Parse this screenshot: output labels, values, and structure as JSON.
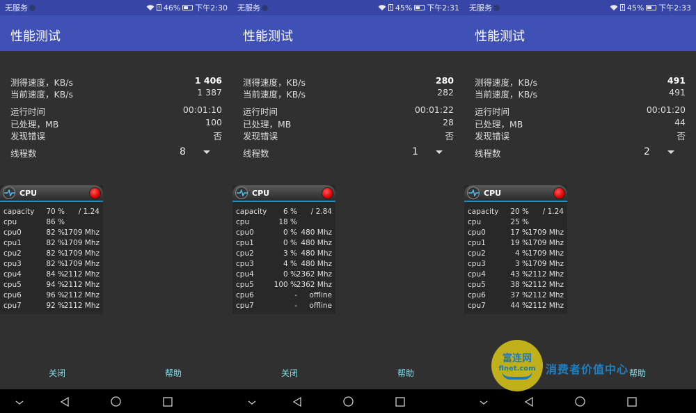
{
  "screens": [
    {
      "status": {
        "carrier": "无服务",
        "battery": "46%",
        "battery_level": 46,
        "time": "下午2:30"
      },
      "title": "性能测试",
      "stats": [
        {
          "label": "测得速度，KB/s",
          "value": "1 406",
          "bold": true
        },
        {
          "label": "当前速度，KB/s",
          "value": "1 387"
        },
        {
          "label": "运行时间",
          "value": "00:01:10"
        },
        {
          "label": "已处理，MB",
          "value": "100"
        },
        {
          "label": "发现错误",
          "value": "否"
        }
      ],
      "threads": {
        "label": "线程数",
        "value": "8"
      },
      "cpu": {
        "title": "CPU",
        "rows": [
          [
            "capacity",
            "70 %",
            "/ 1.24"
          ],
          [
            "cpu",
            "86 %",
            ""
          ],
          [
            "cpu0",
            "82 %",
            "1709 Mhz"
          ],
          [
            "cpu1",
            "82 %",
            "1709 Mhz"
          ],
          [
            "cpu2",
            "82 %",
            "1709 Mhz"
          ],
          [
            "cpu3",
            "82 %",
            "1709 Mhz"
          ],
          [
            "cpu4",
            "84 %",
            "2112 Mhz"
          ],
          [
            "cpu5",
            "94 %",
            "2112 Mhz"
          ],
          [
            "cpu6",
            "96 %",
            "2112 Mhz"
          ],
          [
            "cpu7",
            "92 %",
            "2112 Mhz"
          ]
        ]
      },
      "buttons": {
        "close": "关闭",
        "help": "帮助"
      }
    },
    {
      "status": {
        "carrier": "无服务",
        "battery": "45%",
        "battery_level": 45,
        "time": "下午2:31"
      },
      "title": "性能测试",
      "stats": [
        {
          "label": "测得速度，KB/s",
          "value": "280",
          "bold": true
        },
        {
          "label": "当前速度，KB/s",
          "value": "282"
        },
        {
          "label": "运行时间",
          "value": "00:01:22"
        },
        {
          "label": "已处理，MB",
          "value": "28"
        },
        {
          "label": "发现错误",
          "value": "否"
        }
      ],
      "threads": {
        "label": "线程数",
        "value": "1"
      },
      "cpu": {
        "title": "CPU",
        "rows": [
          [
            "capacity",
            "6 %",
            "/ 2.84"
          ],
          [
            "cpu",
            "18 %",
            ""
          ],
          [
            "cpu0",
            "0 %",
            "480 Mhz"
          ],
          [
            "cpu1",
            "0 %",
            "480 Mhz"
          ],
          [
            "cpu2",
            "3 %",
            "480 Mhz"
          ],
          [
            "cpu3",
            "4 %",
            "480 Mhz"
          ],
          [
            "cpu4",
            "0 %",
            "2362 Mhz"
          ],
          [
            "cpu5",
            "100 %",
            "2362 Mhz"
          ],
          [
            "cpu6",
            "-",
            "offline"
          ],
          [
            "cpu7",
            "-",
            "offline"
          ]
        ]
      },
      "buttons": {
        "close": "关闭",
        "help": "帮助"
      }
    },
    {
      "status": {
        "carrier": "无服务",
        "battery": "45%",
        "battery_level": 45,
        "time": "下午2:33"
      },
      "title": "性能测试",
      "stats": [
        {
          "label": "测得速度，KB/s",
          "value": "491",
          "bold": true
        },
        {
          "label": "当前速度，KB/s",
          "value": "491"
        },
        {
          "label": "运行时间",
          "value": "00:01:20"
        },
        {
          "label": "已处理，MB",
          "value": "44"
        },
        {
          "label": "发现错误",
          "value": "否"
        }
      ],
      "threads": {
        "label": "线程数",
        "value": "2"
      },
      "cpu": {
        "title": "CPU",
        "rows": [
          [
            "capacity",
            "20 %",
            "/ 1.24"
          ],
          [
            "cpu",
            "25 %",
            ""
          ],
          [
            "cpu0",
            "17 %",
            "1709 Mhz"
          ],
          [
            "cpu1",
            "19 %",
            "1709 Mhz"
          ],
          [
            "cpu2",
            "4 %",
            "1709 Mhz"
          ],
          [
            "cpu3",
            "3 %",
            "1709 Mhz"
          ],
          [
            "cpu4",
            "43 %",
            "2112 Mhz"
          ],
          [
            "cpu5",
            "38 %",
            "2112 Mhz"
          ],
          [
            "cpu6",
            "37 %",
            "2112 Mhz"
          ],
          [
            "cpu7",
            "44 %",
            "2112 Mhz"
          ]
        ]
      },
      "buttons": {
        "close": "关闭",
        "help": "帮助"
      }
    }
  ],
  "watermark": {
    "logo_name": "富连网",
    "logo_domain": "flnet.com",
    "slogan": "消费者价值中心"
  },
  "colors": {
    "appbar": "#3f51b5",
    "statusbar": "#3746a6",
    "background": "#303030",
    "button_text": "#80deea",
    "record": "#e00000"
  }
}
